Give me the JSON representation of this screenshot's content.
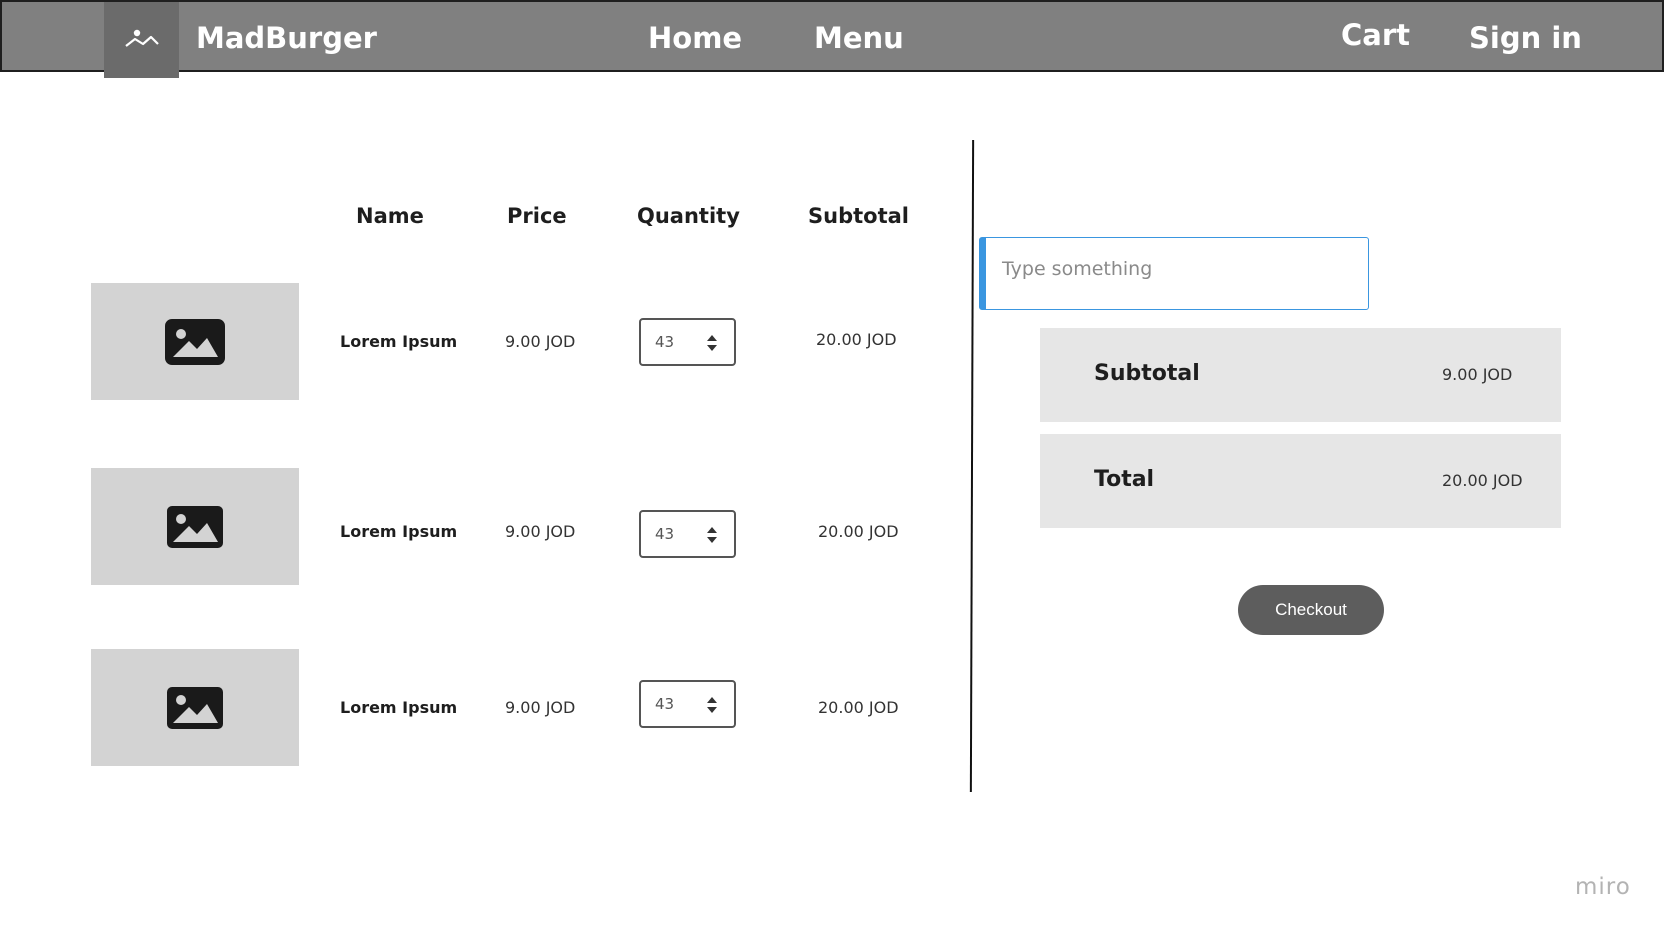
{
  "header": {
    "brand": "MadBurger",
    "logo_icon": "image-placeholder-icon",
    "nav": {
      "home": "Home",
      "menu": "Menu",
      "cart": "Cart",
      "sign_in": "Sign in"
    }
  },
  "cart_table": {
    "columns": {
      "name": "Name",
      "price": "Price",
      "quantity": "Quantity",
      "subtotal": "Subtotal"
    },
    "rows": [
      {
        "thumbnail_icon": "image-icon",
        "name": "Lorem Ipsum",
        "price": "9.00 JOD",
        "quantity": "43",
        "subtotal": "20.00 JOD"
      },
      {
        "thumbnail_icon": "image-icon",
        "name": "Lorem Ipsum",
        "price": "9.00 JOD",
        "quantity": "43",
        "subtotal": "20.00 JOD"
      },
      {
        "thumbnail_icon": "image-icon",
        "name": "Lorem Ipsum",
        "price": "9.00 JOD",
        "quantity": "43",
        "subtotal": "20.00 JOD"
      }
    ]
  },
  "summary": {
    "input_placeholder": "Type something",
    "subtotal_label": "Subtotal",
    "subtotal_value": "9.00 JOD",
    "total_label": "Total",
    "total_value": "20.00 JOD",
    "checkout_label": "Checkout"
  },
  "watermark": "miro",
  "colors": {
    "navbar": "#808080",
    "accent": "#3a96e0",
    "checkout": "#5d5d5d"
  }
}
